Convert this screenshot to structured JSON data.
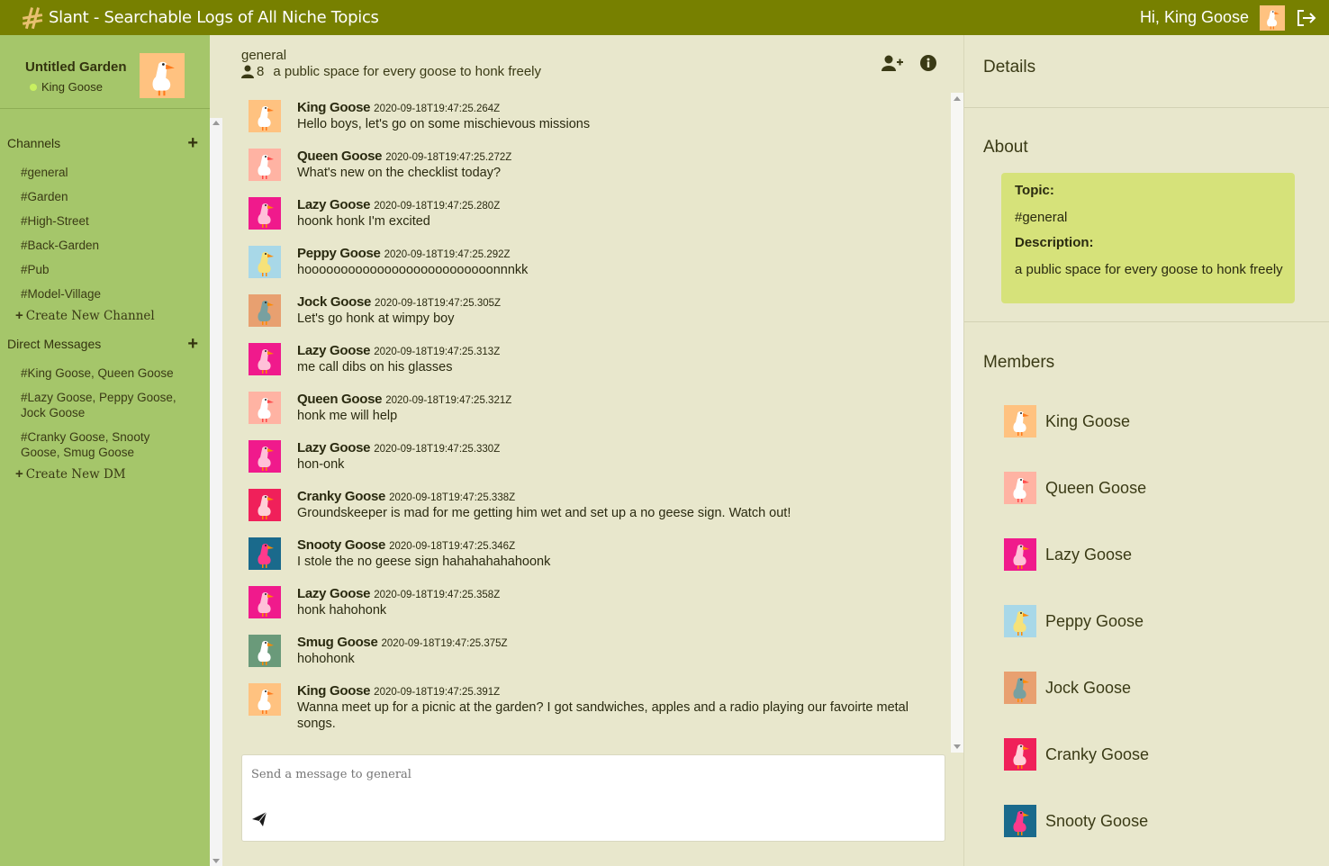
{
  "app": {
    "title": "Slant - Searchable Logs of All Niche Topics",
    "greeting": "Hi, King Goose"
  },
  "workspace": {
    "name": "Untitled Garden",
    "user": "King Goose"
  },
  "sidebar": {
    "channels_label": "Channels",
    "channels": [
      "#general",
      "#Garden",
      "#High-Street",
      "#Back-Garden",
      "#Pub",
      "#Model-Village"
    ],
    "create_channel": "Create New Channel",
    "dm_label": "Direct Messages",
    "dms": [
      "#King Goose, Queen Goose",
      "#Lazy Goose, Peppy Goose, Jock Goose",
      "#Cranky Goose, Snooty Goose, Smug Goose"
    ],
    "create_dm": "Create New DM"
  },
  "channel": {
    "name": "general",
    "member_count": "8",
    "description": "a public space for every goose to honk freely"
  },
  "messages": [
    {
      "author": "King Goose",
      "ts": "2020-09-18T19:47:25.264Z",
      "text": "Hello boys, let's go on some mischievous missions",
      "avatar": "king"
    },
    {
      "author": "Queen Goose",
      "ts": "2020-09-18T19:47:25.272Z",
      "text": "What's new on the checklist today?",
      "avatar": "queen"
    },
    {
      "author": "Lazy Goose",
      "ts": "2020-09-18T19:47:25.280Z",
      "text": "hoonk honk I'm excited",
      "avatar": "lazy"
    },
    {
      "author": "Peppy Goose",
      "ts": "2020-09-18T19:47:25.292Z",
      "text": "hoooooooooooooooooooooooooonnnkk",
      "avatar": "peppy"
    },
    {
      "author": "Jock Goose",
      "ts": "2020-09-18T19:47:25.305Z",
      "text": "Let's go honk at wimpy boy",
      "avatar": "jock"
    },
    {
      "author": "Lazy Goose",
      "ts": "2020-09-18T19:47:25.313Z",
      "text": "me call dibs on his glasses",
      "avatar": "lazy"
    },
    {
      "author": "Queen Goose",
      "ts": "2020-09-18T19:47:25.321Z",
      "text": "honk me will help",
      "avatar": "queen"
    },
    {
      "author": "Lazy Goose",
      "ts": "2020-09-18T19:47:25.330Z",
      "text": "hon-onk",
      "avatar": "lazy"
    },
    {
      "author": "Cranky Goose",
      "ts": "2020-09-18T19:47:25.338Z",
      "text": "Groundskeeper is mad for me getting him wet and set up a no geese sign. Watch out!",
      "avatar": "cranky"
    },
    {
      "author": "Snooty Goose",
      "ts": "2020-09-18T19:47:25.346Z",
      "text": "I stole the no geese sign hahahahahahoonk",
      "avatar": "snooty"
    },
    {
      "author": "Lazy Goose",
      "ts": "2020-09-18T19:47:25.358Z",
      "text": "honk hahohonk",
      "avatar": "lazy"
    },
    {
      "author": "Smug Goose",
      "ts": "2020-09-18T19:47:25.375Z",
      "text": "hohohonk",
      "avatar": "smug"
    },
    {
      "author": "King Goose",
      "ts": "2020-09-18T19:47:25.391Z",
      "text": "Wanna meet up for a picnic at the garden? I got sandwiches, apples and a radio playing our favoirte metal songs.",
      "avatar": "king"
    }
  ],
  "composer": {
    "placeholder": "Send a message to general"
  },
  "details": {
    "title": "Details",
    "about_title": "About",
    "topic_label": "Topic:",
    "topic_value": "#general",
    "desc_label": "Description:",
    "desc_value": "a public space for every goose to honk freely",
    "members_title": "Members",
    "members": [
      {
        "name": "King Goose",
        "avatar": "king"
      },
      {
        "name": "Queen Goose",
        "avatar": "queen"
      },
      {
        "name": "Lazy Goose",
        "avatar": "lazy"
      },
      {
        "name": "Peppy Goose",
        "avatar": "peppy"
      },
      {
        "name": "Jock Goose",
        "avatar": "jock"
      },
      {
        "name": "Cranky Goose",
        "avatar": "cranky"
      },
      {
        "name": "Snooty Goose",
        "avatar": "snooty"
      }
    ]
  },
  "avatar_styles": {
    "king": {
      "bg": "#ffc280",
      "body": "#ffffff",
      "accent": "#ff7a1a"
    },
    "queen": {
      "bg": "#ffb3a3",
      "body": "#ffffff",
      "accent": "#ff4a4a"
    },
    "lazy": {
      "bg": "#f01a8c",
      "body": "#ffc0d8",
      "accent": "#ff8a00"
    },
    "peppy": {
      "bg": "#a8d8e8",
      "body": "#f6e27a",
      "accent": "#ff8a00"
    },
    "jock": {
      "bg": "#e8a070",
      "body": "#78a0a0",
      "accent": "#ff8a00"
    },
    "cranky": {
      "bg": "#f0205a",
      "body": "#ffd0d8",
      "accent": "#ff8a00"
    },
    "snooty": {
      "bg": "#1a6a8c",
      "body": "#ff3a8c",
      "accent": "#ff8a00"
    },
    "smug": {
      "bg": "#6a9a7a",
      "body": "#ffffff",
      "accent": "#ff8a00"
    }
  },
  "colors": {
    "topbar": "#778000",
    "sidebar": "#a5c66a",
    "about_box": "#d6e27a"
  }
}
